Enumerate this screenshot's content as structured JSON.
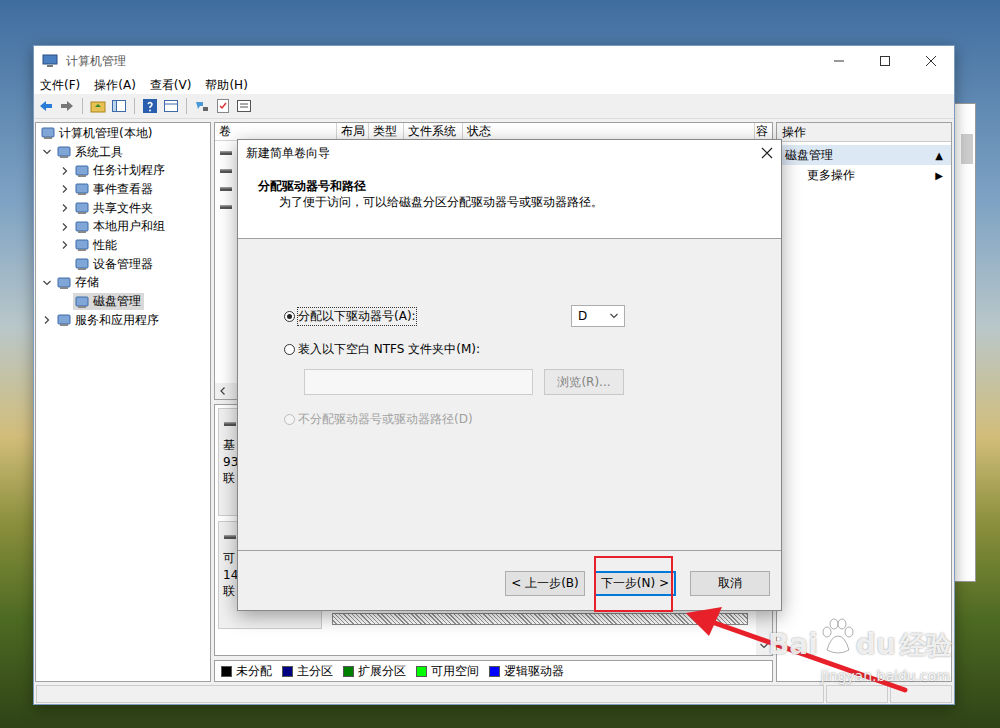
{
  "window": {
    "title": "计算机管理"
  },
  "menu": [
    "文件(F)",
    "操作(A)",
    "查看(V)",
    "帮助(H)"
  ],
  "tree": [
    {
      "label": "计算机管理(本地)",
      "expandable": false,
      "expanded": false,
      "selected": false,
      "children": [
        {
          "label": "系统工具",
          "expandable": true,
          "expanded": true,
          "selected": false,
          "children": [
            {
              "label": "任务计划程序",
              "expandable": true,
              "expanded": false,
              "selected": false,
              "children": []
            },
            {
              "label": "事件查看器",
              "expandable": true,
              "expanded": false,
              "selected": false,
              "children": []
            },
            {
              "label": "共享文件夹",
              "expandable": true,
              "expanded": false,
              "selected": false,
              "children": []
            },
            {
              "label": "本地用户和组",
              "expandable": true,
              "expanded": false,
              "selected": false,
              "children": []
            },
            {
              "label": "性能",
              "expandable": true,
              "expanded": false,
              "selected": false,
              "children": []
            },
            {
              "label": "设备管理器",
              "expandable": false,
              "expanded": false,
              "selected": false,
              "children": []
            }
          ]
        },
        {
          "label": "存储",
          "expandable": true,
          "expanded": true,
          "selected": false,
          "children": [
            {
              "label": "磁盘管理",
              "expandable": false,
              "expanded": false,
              "selected": true,
              "children": []
            }
          ]
        },
        {
          "label": "服务和应用程序",
          "expandable": true,
          "expanded": false,
          "selected": false,
          "children": []
        }
      ]
    }
  ],
  "table": {
    "columns": [
      "卷",
      "布局",
      "类型",
      "文件系统",
      "状态",
      "容"
    ]
  },
  "disks": [
    {
      "lines": [
        "基",
        "93",
        "联"
      ]
    },
    {
      "lines": [
        "可",
        "14",
        "联"
      ]
    }
  ],
  "legend": [
    {
      "label": "未分配",
      "color": "#000000"
    },
    {
      "label": "主分区",
      "color": "#000080"
    },
    {
      "label": "扩展分区",
      "color": "#008000"
    },
    {
      "label": "可用空间",
      "color": "#00ff00"
    },
    {
      "label": "逻辑驱动器",
      "color": "#0000ff"
    }
  ],
  "actions": {
    "header": "操作",
    "items": [
      {
        "label": "磁盘管理",
        "arrow": "▲",
        "selected": true
      },
      {
        "label": "更多操作",
        "arrow": "▶",
        "selected": false
      }
    ]
  },
  "dialog": {
    "title": "新建简单卷向导",
    "heading": "分配驱动器号和路径",
    "subheading": "为了便于访问，可以给磁盘分区分配驱动器号或驱动器路径。",
    "options": [
      {
        "label": "分配以下驱动器号(A):",
        "selected": true,
        "disabled": false
      },
      {
        "label": "装入以下空白 NTFS 文件夹中(M):",
        "selected": false,
        "disabled": false
      },
      {
        "label": "不分配驱动器号或驱动器路径(D)",
        "selected": false,
        "disabled": true
      }
    ],
    "drive_letter": "D",
    "folder_path": "",
    "browse": {
      "label": "浏览(R)...",
      "disabled": true
    },
    "buttons": [
      {
        "label": "< 上一步(B)",
        "default": false,
        "highlighted": false
      },
      {
        "label": "下一步(N) >",
        "default": true,
        "highlighted": true
      },
      {
        "label": "取消",
        "default": false,
        "highlighted": false
      }
    ]
  },
  "watermark": {
    "brand_left": "Bai",
    "brand_right": "du",
    "product": "经验",
    "url": "jingyan.baidu.com"
  }
}
